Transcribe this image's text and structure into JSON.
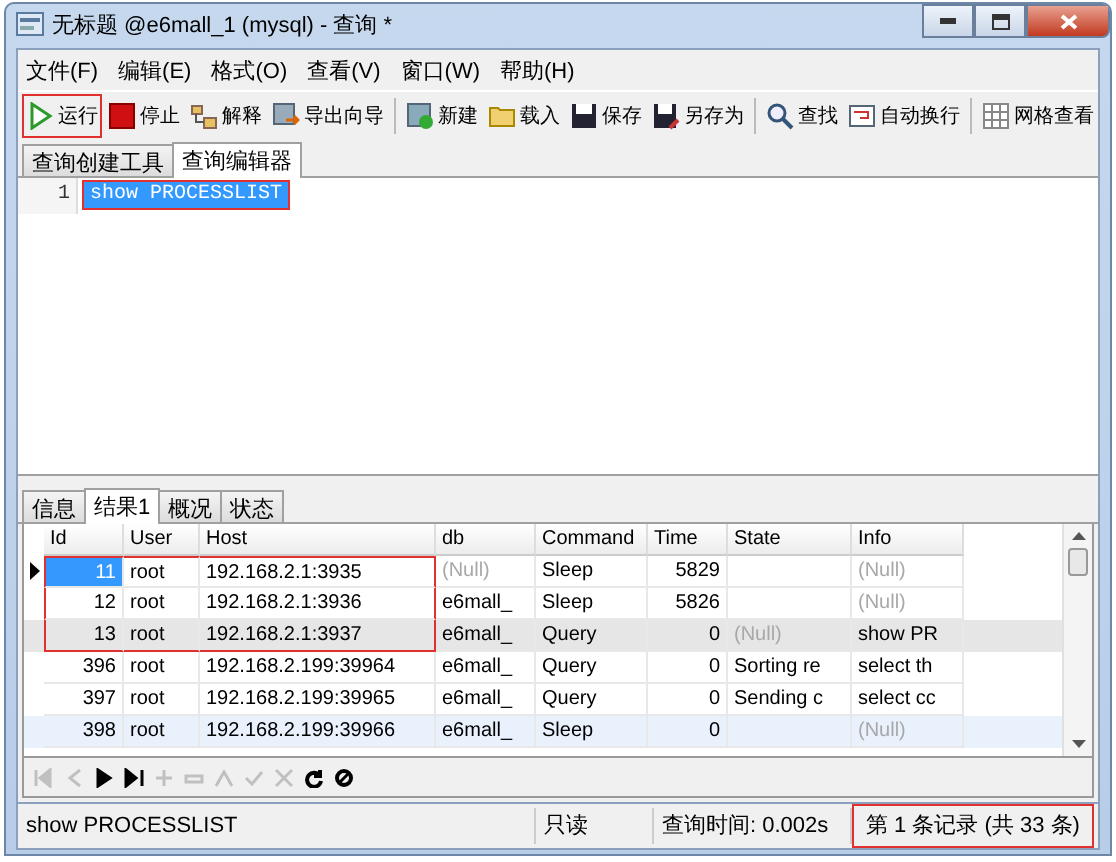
{
  "window": {
    "title": "无标题 @e6mall_1 (mysql) - 查询 *"
  },
  "menu": [
    "文件(F)",
    "编辑(E)",
    "格式(O)",
    "查看(V)",
    "窗口(W)",
    "帮助(H)"
  ],
  "toolbar": [
    {
      "kind": "button",
      "label": "运行",
      "boxed": true
    },
    {
      "kind": "button",
      "label": "停止",
      "boxed": false
    },
    {
      "kind": "button",
      "label": "解释",
      "boxed": false
    },
    {
      "kind": "button",
      "label": "导出向导",
      "boxed": false
    },
    {
      "kind": "separator"
    },
    {
      "kind": "button",
      "label": "新建",
      "boxed": false
    },
    {
      "kind": "button",
      "label": "载入",
      "boxed": false
    },
    {
      "kind": "button",
      "label": "保存",
      "boxed": false
    },
    {
      "kind": "button",
      "label": "另存为",
      "boxed": false
    },
    {
      "kind": "separator"
    },
    {
      "kind": "button",
      "label": "查找",
      "boxed": false
    },
    {
      "kind": "button",
      "label": "自动换行",
      "boxed": false
    },
    {
      "kind": "separator"
    },
    {
      "kind": "button",
      "label": "网格查看",
      "boxed": false
    }
  ],
  "editor_tabs": [
    {
      "label": "查询创建工具",
      "selected": false
    },
    {
      "label": "查询编辑器",
      "selected": true
    }
  ],
  "editor": {
    "lines": [
      {
        "number": "1",
        "text": "show PROCESSLIST",
        "selected": true,
        "boxed": true
      }
    ]
  },
  "result_tabs": [
    {
      "label": "信息",
      "selected": false
    },
    {
      "label": "结果1",
      "selected": true
    },
    {
      "label": "概况",
      "selected": false
    },
    {
      "label": "状态",
      "selected": false
    }
  ],
  "grid": {
    "columns": [
      "Id",
      "User",
      "Host",
      "db",
      "Command",
      "Time",
      "State",
      "Info"
    ],
    "rows": [
      {
        "selected": true,
        "current": false,
        "hover": false,
        "boxed": true,
        "cells": [
          "11",
          "root",
          "192.168.2.1:3935",
          {
            "text": "(Null)",
            "null": true
          },
          "Sleep",
          "5829",
          null,
          {
            "text": "(Null)",
            "null": true
          }
        ]
      },
      {
        "selected": false,
        "current": false,
        "hover": false,
        "boxed": true,
        "cells": [
          "12",
          "root",
          "192.168.2.1:3936",
          "e6mall_",
          "Sleep",
          "5826",
          null,
          {
            "text": "(Null)",
            "null": true
          }
        ]
      },
      {
        "selected": false,
        "current": true,
        "hover": false,
        "boxed": true,
        "cells": [
          "13",
          "root",
          "192.168.2.1:3937",
          "e6mall_",
          "Query",
          "0",
          {
            "text": "(Null)",
            "null": true
          },
          "show PR"
        ]
      },
      {
        "selected": false,
        "current": false,
        "hover": false,
        "boxed": false,
        "cells": [
          "396",
          "root",
          "192.168.2.199:39964",
          "e6mall_",
          "Query",
          "0",
          "Sorting re",
          "select th"
        ]
      },
      {
        "selected": false,
        "current": false,
        "hover": false,
        "boxed": false,
        "cells": [
          "397",
          "root",
          "192.168.2.199:39965",
          "e6mall_",
          "Query",
          "0",
          "Sending c",
          "select cc"
        ]
      },
      {
        "selected": false,
        "current": false,
        "hover": true,
        "boxed": false,
        "cells": [
          "398",
          "root",
          "192.168.2.199:39966",
          "e6mall_",
          "Sleep",
          "0",
          null,
          {
            "text": "(Null)",
            "null": true
          }
        ]
      }
    ]
  },
  "nav_buttons": [
    {
      "disabled": true
    },
    {
      "disabled": true
    },
    {
      "disabled": false
    },
    {
      "disabled": false
    },
    {
      "disabled": true
    },
    {
      "disabled": true
    },
    {
      "disabled": true
    },
    {
      "disabled": true
    },
    {
      "disabled": true
    },
    {
      "disabled": false
    },
    {
      "disabled": false
    }
  ],
  "status_bar": [
    {
      "text": "show PROCESSLIST",
      "boxed": false
    },
    {
      "text": "只读",
      "boxed": false
    },
    {
      "text": "查询时间: 0.002s",
      "boxed": false
    },
    {
      "text": "第 1 条记录 (共 33 条)",
      "boxed": true
    }
  ]
}
